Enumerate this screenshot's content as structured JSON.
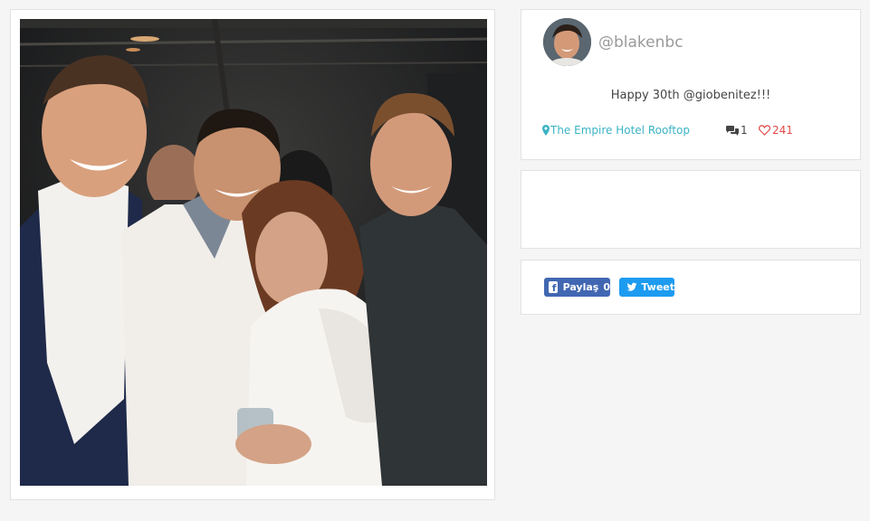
{
  "post": {
    "username": "@blakenbc",
    "caption": "Happy 30th @giobenitez!!!",
    "location": "The Empire Hotel Rooftop",
    "comment_count": "1",
    "like_count": "241"
  },
  "share": {
    "facebook_label": "Paylaş",
    "facebook_count": "0",
    "twitter_label": "Tweet"
  },
  "icons": {
    "location": "map-pin-icon",
    "comments": "comments-icon",
    "likes": "heart-icon",
    "facebook": "facebook-icon",
    "twitter": "twitter-icon"
  },
  "colors": {
    "location_text": "#3bb3c3",
    "like_text": "#e24a4a",
    "facebook_button": "#4267b2",
    "twitter_button": "#1d9bf0"
  }
}
